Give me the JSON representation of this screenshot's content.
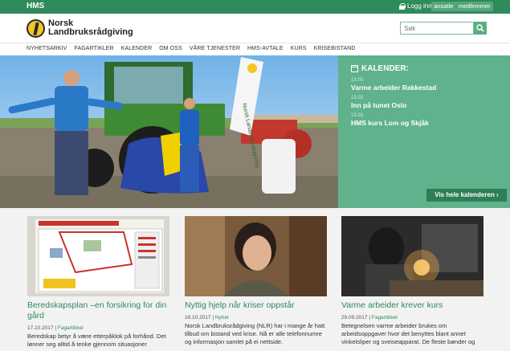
{
  "topbar": {
    "section": "HMS",
    "login_label": "Logg inn:",
    "login_employees": "ansatte",
    "login_members": "medlemmer"
  },
  "header": {
    "logo_line1": "Norsk",
    "logo_line2": "Landbruksrådgiving",
    "search_placeholder": "Søk"
  },
  "nav": {
    "items": [
      "NYHETSARKIV",
      "FAGARTIKLER",
      "KALENDER",
      "OM OSS",
      "VÅRE TJENESTER",
      "HMS-AVTALE",
      "KURS",
      "KRISEBISTAND"
    ]
  },
  "hero": {
    "banner_text": "Norsk Landbruksrådgiving"
  },
  "calendar": {
    "title": "KALENDER:",
    "events": [
      {
        "date": "13.03",
        "name": "Varme arbeider Rakkestad"
      },
      {
        "date": "13.03",
        "name": "Inn på tunet Oslo"
      },
      {
        "date": "13.03",
        "name": "HMS kurs Lom og Skjåk"
      }
    ],
    "all_button": "Vis hele kalenderen ›"
  },
  "cards": [
    {
      "title": "Beredskapsplan –en forsikring for din gård",
      "date": "17.10.2017",
      "category": "Fagartikkel",
      "excerpt": "Beredskap betyr å være etterpåklok på forhånd. Det lønner seg alltid å tenke gjennom situasjoner"
    },
    {
      "title": "Nyttig hjelp når kriser oppstår",
      "date": "18.10.2017",
      "category": "Nyhet",
      "excerpt": "Norsk Landbruksrådgiving (NLR) har i mange år hatt tilbud om bistand ved krise. Nå er alle telefonnumre og informasjon samlet på ei nettside."
    },
    {
      "title": "Varme arbeider krever kurs",
      "date": "29.09.2017",
      "category": "Fagartikkel",
      "excerpt": "Betegnelsen varme arbeider brukes om arbeidsoppgaver hvor det benyttes blant annet vinkelsliper og sveiseapparat. De fleste bønder og"
    }
  ],
  "colors": {
    "brand_green": "#2f8a5c",
    "calendar_green": "#5fb28c"
  }
}
